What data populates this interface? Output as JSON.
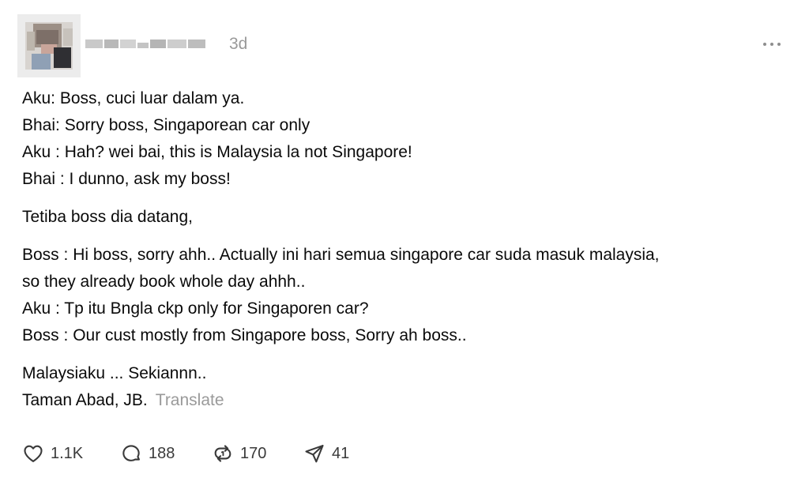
{
  "post": {
    "timestamp": "3d",
    "more_icon": "more-horizontal-icon",
    "paragraphs": [
      {
        "lines": [
          "Aku: Boss, cuci luar dalam ya.",
          "Bhai: Sorry boss, Singaporean car only",
          "Aku : Hah? wei bai, this is Malaysia la not Singapore!",
          "Bhai : I dunno, ask my boss!"
        ]
      },
      {
        "lines": [
          "Tetiba boss dia datang,"
        ]
      },
      {
        "lines": [
          "Boss : Hi boss, sorry ahh.. Actually ini hari semua singapore car suda masuk malaysia,",
          "so they already book whole day ahhh..",
          "Aku : Tp itu Bngla ckp only for Singaporen car?",
          "Boss : Our cust mostly from Singapore boss, Sorry ah boss.."
        ]
      },
      {
        "lines": [
          "Malaysiaku ... Sekiannn..",
          "Taman Abad, JB."
        ]
      }
    ],
    "translate_label": "Translate"
  },
  "actions": {
    "like": {
      "icon": "heart-icon",
      "count": "1.1K"
    },
    "comment": {
      "icon": "comment-bubble-icon",
      "count": "188"
    },
    "repost": {
      "icon": "repost-icon",
      "count": "170"
    },
    "share": {
      "icon": "send-icon",
      "count": "41"
    }
  },
  "colors": {
    "text": "#0a0a0a",
    "muted": "#9a9a9a",
    "icon": "#3a3a3a"
  }
}
